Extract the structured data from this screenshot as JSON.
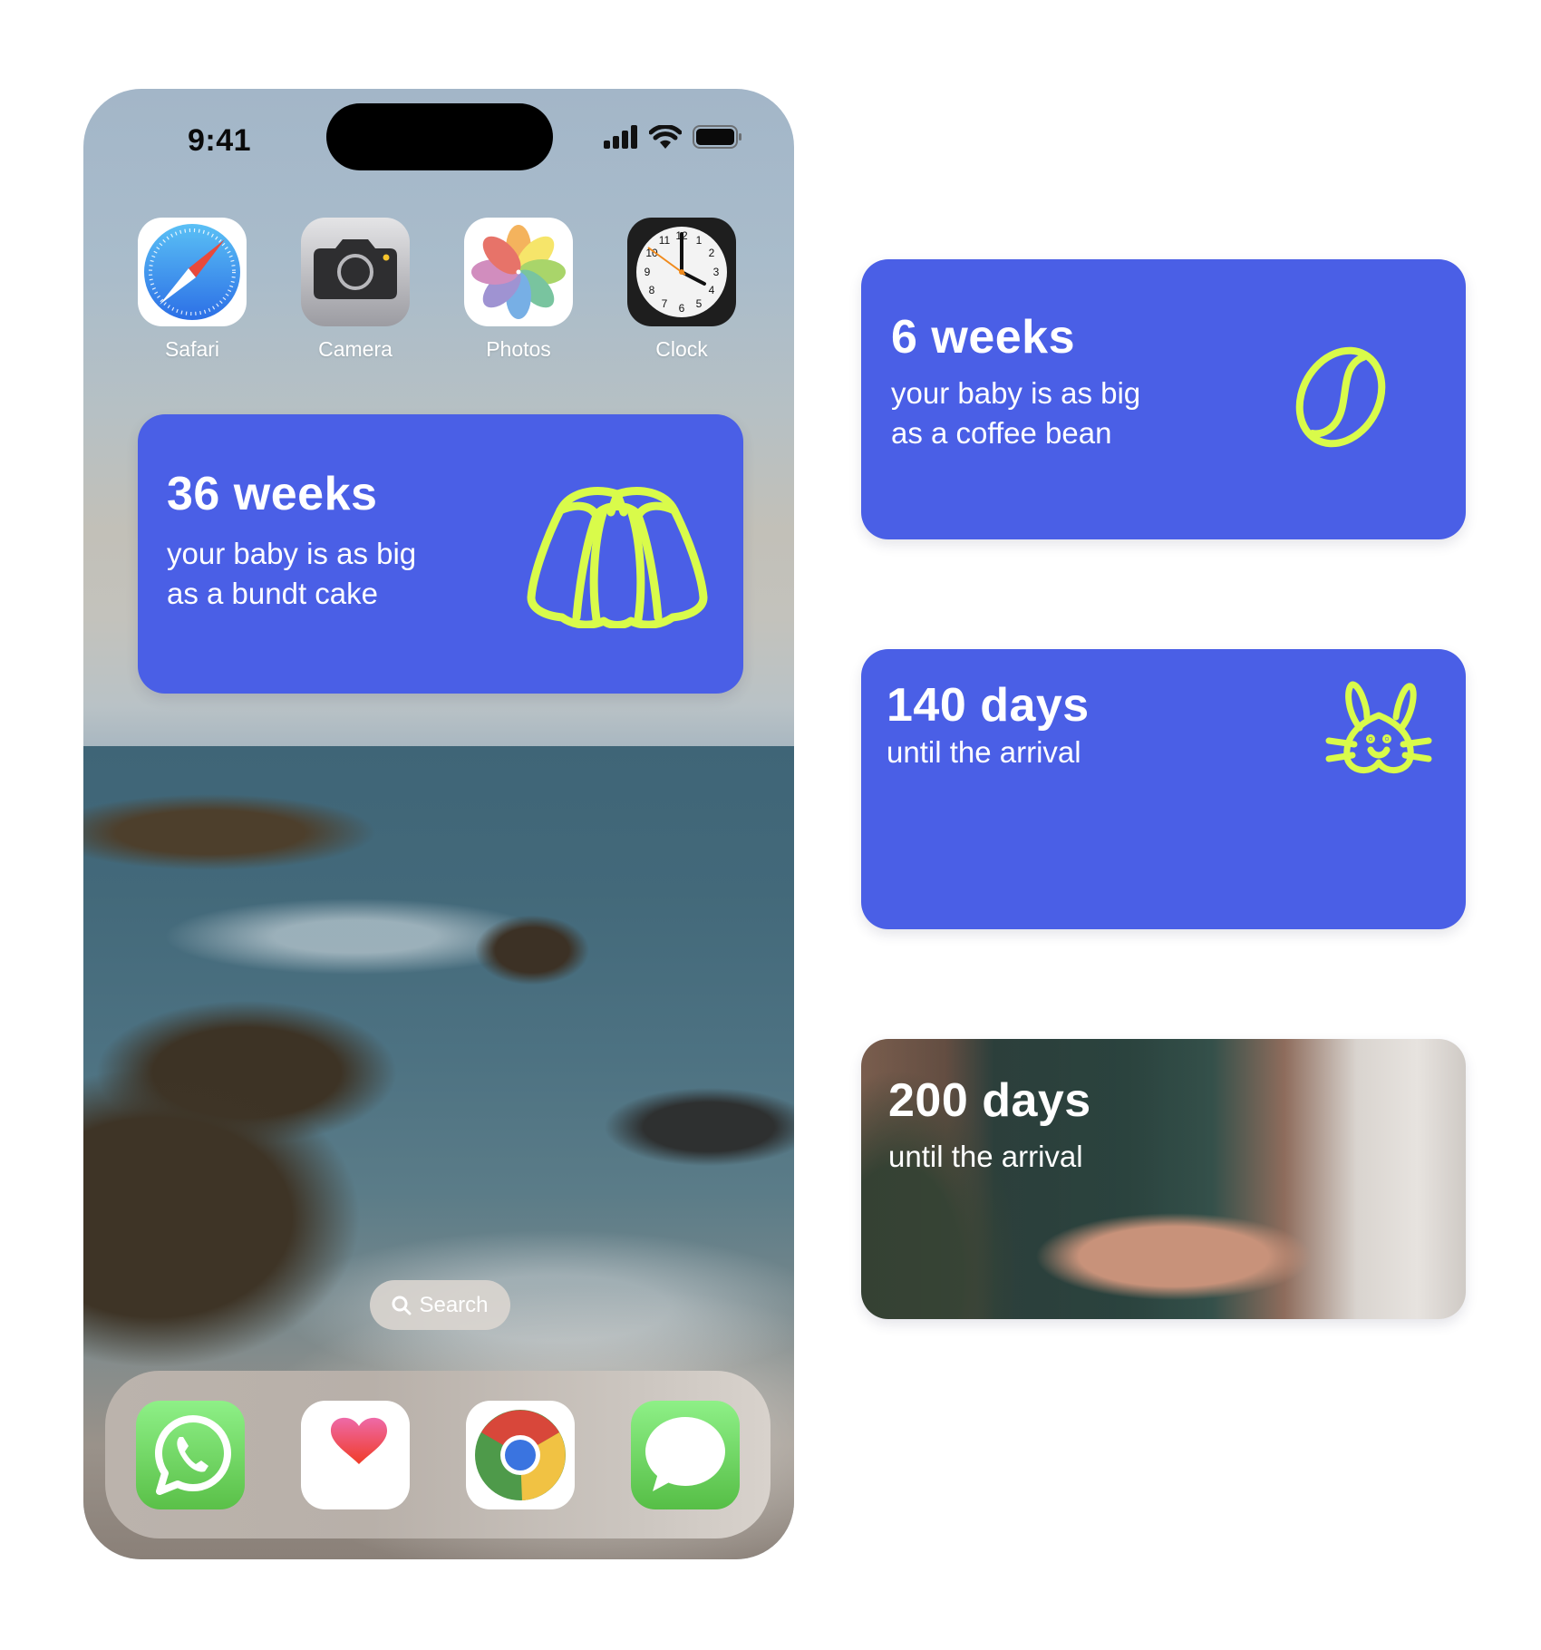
{
  "phone": {
    "status_bar": {
      "time": "9:41",
      "icons": [
        "cellular-signal-icon",
        "wifi-icon",
        "battery-icon"
      ]
    },
    "apps": [
      {
        "label": "Safari",
        "icon": "safari-icon"
      },
      {
        "label": "Camera",
        "icon": "camera-icon"
      },
      {
        "label": "Photos",
        "icon": "photos-icon"
      },
      {
        "label": "Clock",
        "icon": "clock-icon"
      }
    ],
    "widget": {
      "title": "36 weeks",
      "line1": "your baby is as big",
      "line2": "as a bundt cake",
      "icon": "bundt-cake-icon"
    },
    "search": {
      "label": "Search",
      "icon": "search-icon"
    },
    "dock": [
      {
        "app": "WhatsApp",
        "icon": "whatsapp-icon"
      },
      {
        "app": "Health",
        "icon": "health-heart-icon"
      },
      {
        "app": "Chrome",
        "icon": "chrome-icon"
      },
      {
        "app": "Messages",
        "icon": "messages-icon"
      }
    ]
  },
  "side_widgets": [
    {
      "title": "6 weeks",
      "line1": "your baby is as big",
      "line2": "as a coffee bean",
      "icon": "coffee-bean-icon"
    },
    {
      "title": "140 days",
      "line1": "until the arrival",
      "icon": "bunny-icon"
    },
    {
      "title": "200 days",
      "line1": "until the arrival",
      "background": "pregnant-belly-photo"
    }
  ],
  "colors": {
    "widget_bg": "#4A5FE6",
    "accent": "#D9FB4A",
    "text": "#FFFFFF"
  }
}
